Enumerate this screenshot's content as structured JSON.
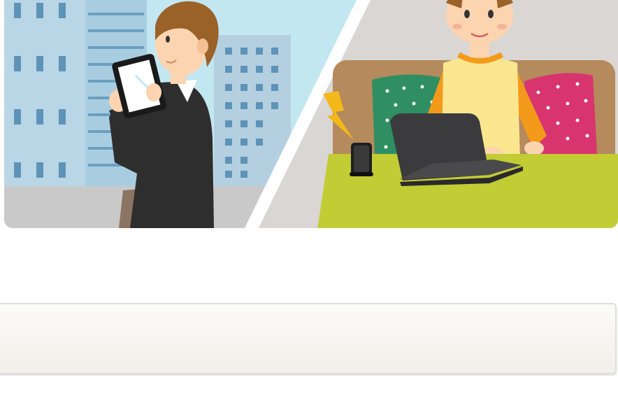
{
  "hero": {
    "scene_left": "man-with-tablet-in-city",
    "scene_right": "person-with-laptop-on-sofa",
    "icons": {
      "tablet": "tablet-icon",
      "laptop": "laptop-icon",
      "router": "wifi-router-icon",
      "signal": "lightning-bolt-icon"
    },
    "colors": {
      "sky": "#c3e7f1",
      "building_light": "#a9cde0",
      "building_mid": "#b4cfe0",
      "window": "#5e93b8",
      "ground": "#c9c9c9",
      "wall": "#dad6d3",
      "sofa": "#b58a5d",
      "table": "#c2cc35",
      "cushion_green": "#2f8f63",
      "cushion_pink": "#d8356f",
      "shirt": "#fbe690",
      "sleeve": "#f39a1b",
      "laptop": "#3b3b3d",
      "suit": "#2e2e2e",
      "hair": "#9a6228",
      "skin": "#fcd4b0",
      "bag": "#8c7463",
      "bolt": "#f4b81a"
    }
  },
  "panel": {
    "text": ""
  },
  "footnote": {
    "text": ""
  }
}
